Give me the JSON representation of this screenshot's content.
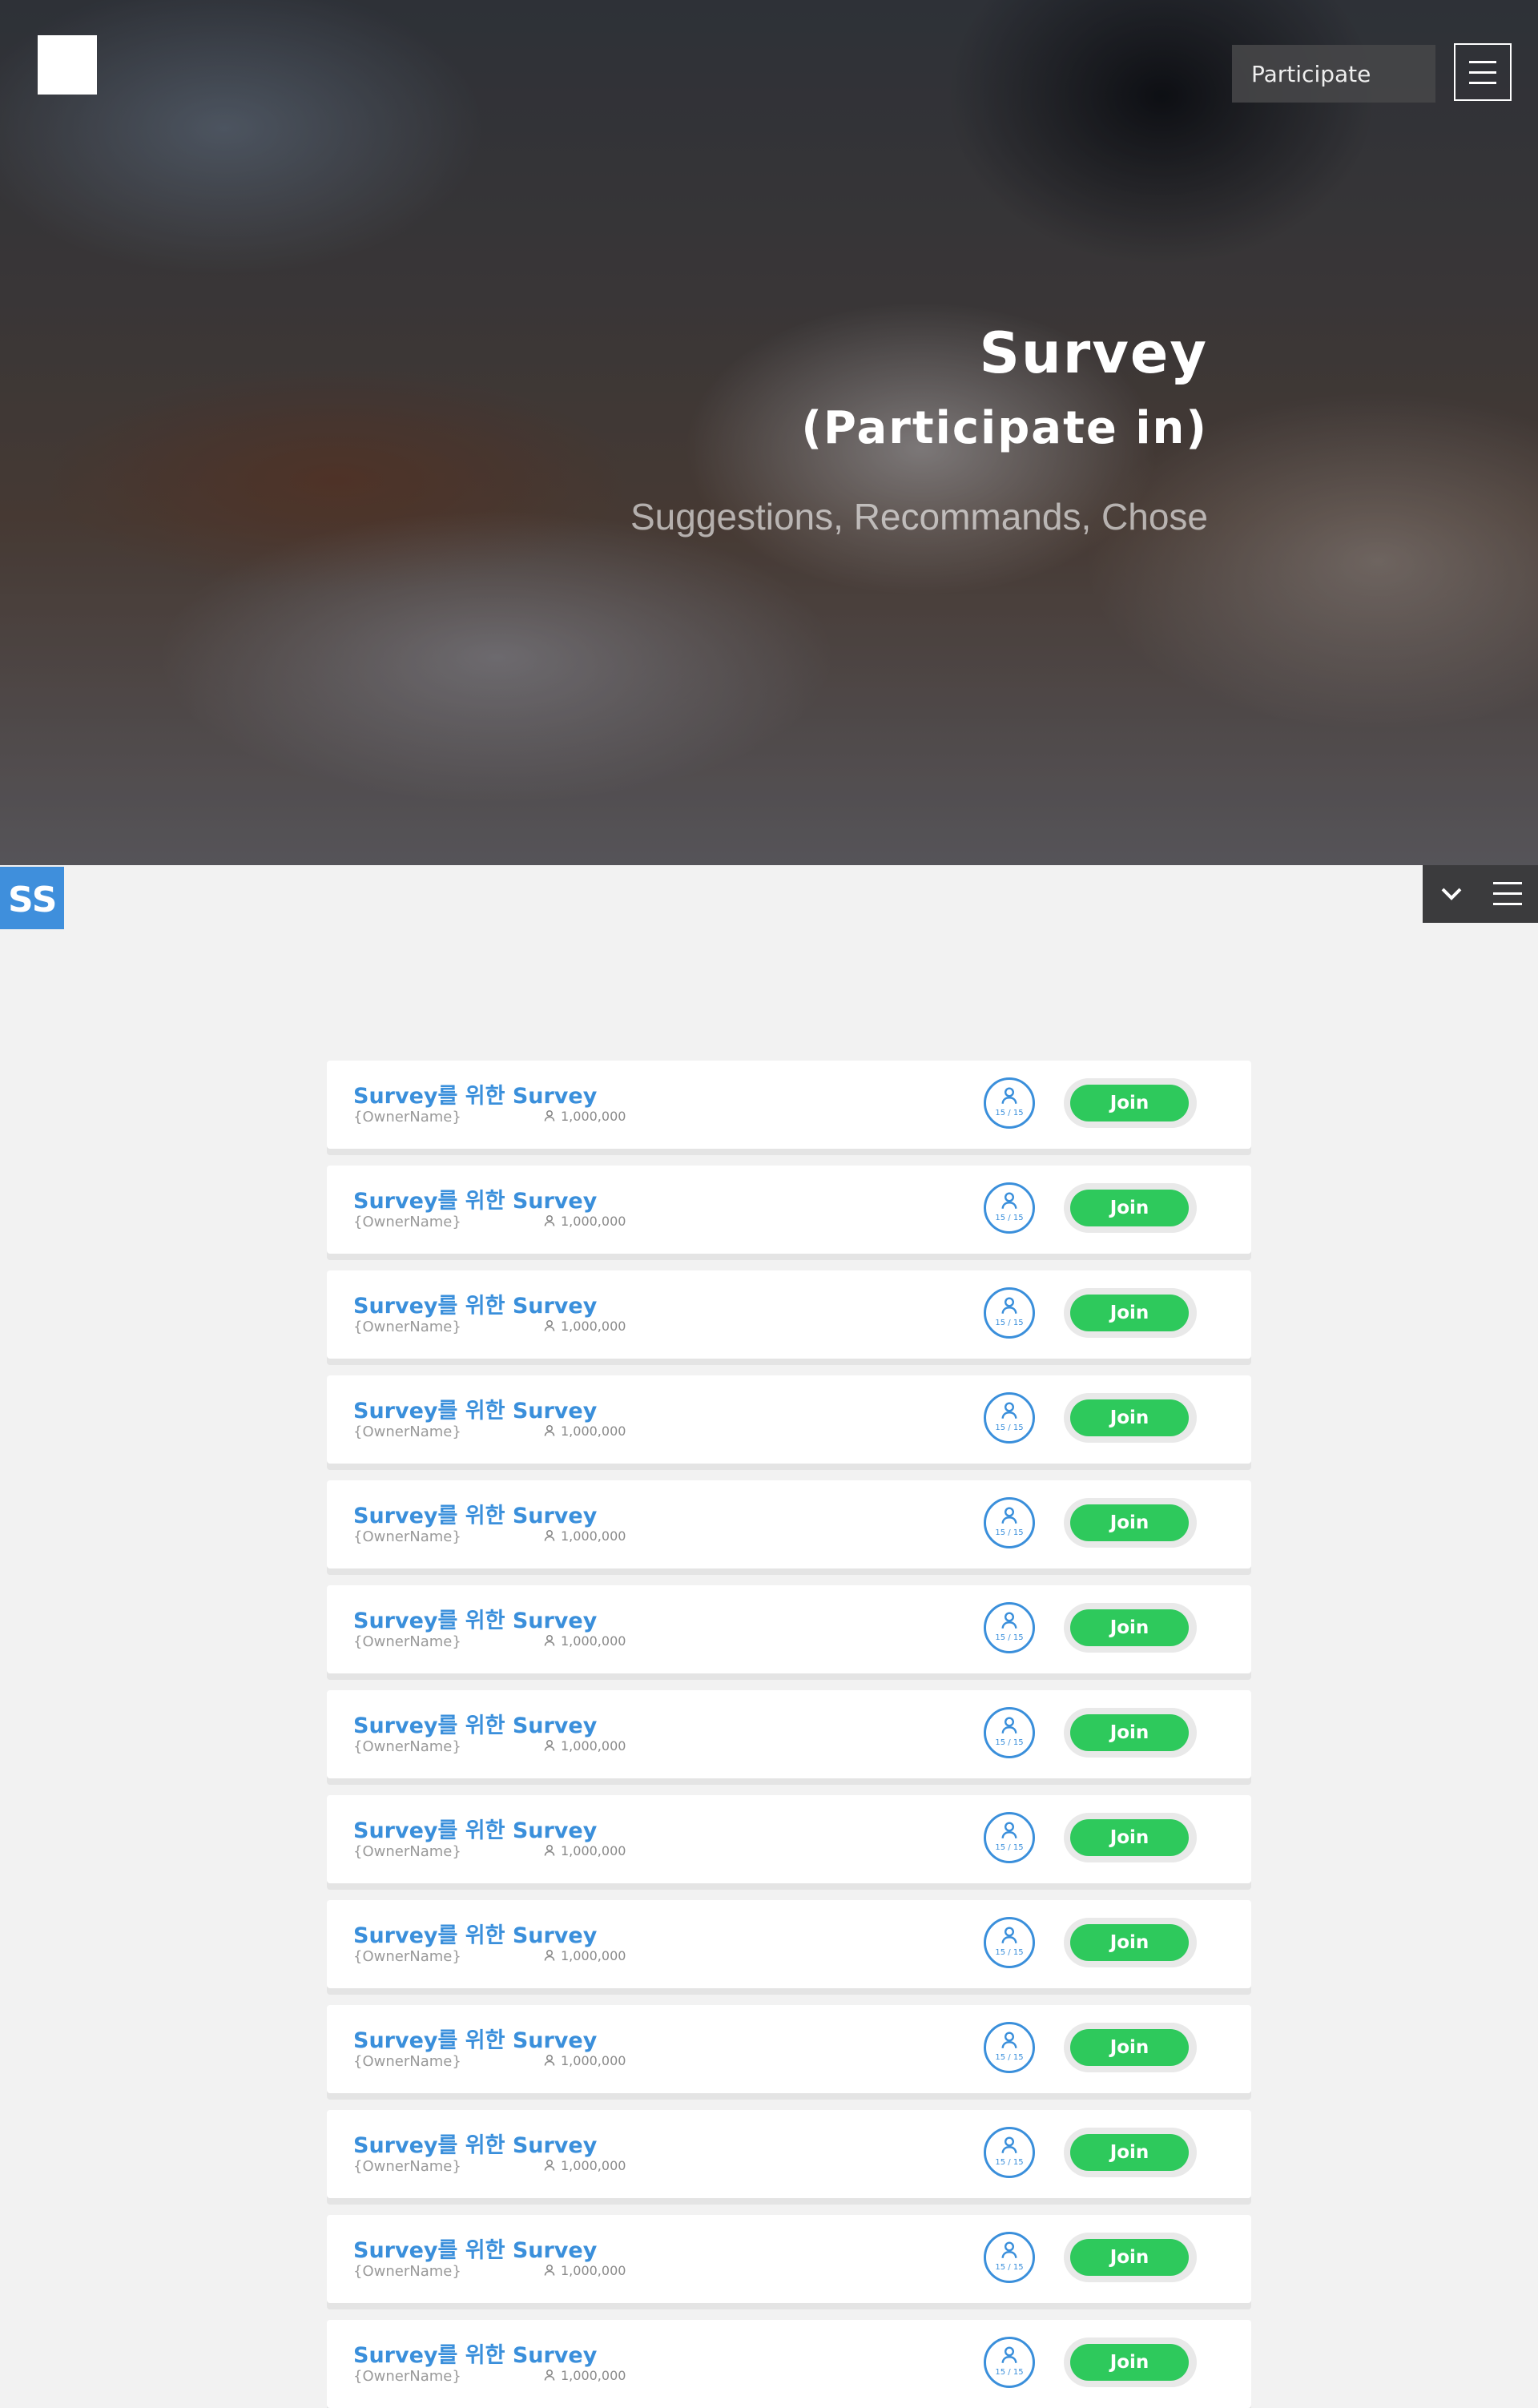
{
  "header": {
    "participate_label": "Participate",
    "menu_icon": "hamburger-icon"
  },
  "hero": {
    "title": "Survey",
    "subtitle": "(Participate in)",
    "tagline": "Suggestions, Recommands, Chose"
  },
  "toolbar": {
    "logo_text": "SS",
    "collapse_icon": "chevron-down-icon",
    "menu_icon": "hamburger-icon"
  },
  "colors": {
    "accent": "#3a8fdb",
    "join": "#2ec95c",
    "background": "#f2f2f2"
  },
  "surveys": [
    {
      "title": "Survey를 위한 Survey",
      "owner": "{OwnerName}",
      "participants": "1,000,000",
      "slots": "15 / 15",
      "join_label": "Join"
    },
    {
      "title": "Survey를 위한 Survey",
      "owner": "{OwnerName}",
      "participants": "1,000,000",
      "slots": "15 / 15",
      "join_label": "Join"
    },
    {
      "title": "Survey를 위한 Survey",
      "owner": "{OwnerName}",
      "participants": "1,000,000",
      "slots": "15 / 15",
      "join_label": "Join"
    },
    {
      "title": "Survey를 위한 Survey",
      "owner": "{OwnerName}",
      "participants": "1,000,000",
      "slots": "15 / 15",
      "join_label": "Join"
    },
    {
      "title": "Survey를 위한 Survey",
      "owner": "{OwnerName}",
      "participants": "1,000,000",
      "slots": "15 / 15",
      "join_label": "Join"
    },
    {
      "title": "Survey를 위한 Survey",
      "owner": "{OwnerName}",
      "participants": "1,000,000",
      "slots": "15 / 15",
      "join_label": "Join"
    },
    {
      "title": "Survey를 위한 Survey",
      "owner": "{OwnerName}",
      "participants": "1,000,000",
      "slots": "15 / 15",
      "join_label": "Join"
    },
    {
      "title": "Survey를 위한 Survey",
      "owner": "{OwnerName}",
      "participants": "1,000,000",
      "slots": "15 / 15",
      "join_label": "Join"
    },
    {
      "title": "Survey를 위한 Survey",
      "owner": "{OwnerName}",
      "participants": "1,000,000",
      "slots": "15 / 15",
      "join_label": "Join"
    },
    {
      "title": "Survey를 위한 Survey",
      "owner": "{OwnerName}",
      "participants": "1,000,000",
      "slots": "15 / 15",
      "join_label": "Join"
    },
    {
      "title": "Survey를 위한 Survey",
      "owner": "{OwnerName}",
      "participants": "1,000,000",
      "slots": "15 / 15",
      "join_label": "Join"
    },
    {
      "title": "Survey를 위한 Survey",
      "owner": "{OwnerName}",
      "participants": "1,000,000",
      "slots": "15 / 15",
      "join_label": "Join"
    },
    {
      "title": "Survey를 위한 Survey",
      "owner": "{OwnerName}",
      "participants": "1,000,000",
      "slots": "15 / 15",
      "join_label": "Join"
    }
  ]
}
